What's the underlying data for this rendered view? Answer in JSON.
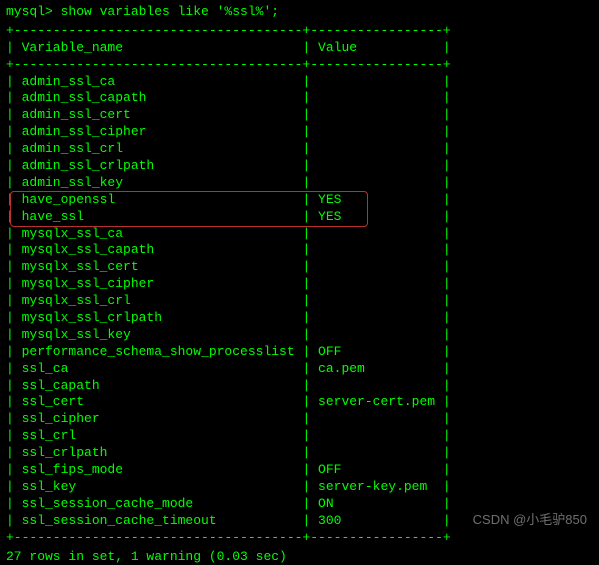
{
  "prompt": "mysql> show variables like '%ssl%';",
  "border_top": "+-------------------------------------+-----------------+",
  "header_line": "| Variable_name                       | Value           |",
  "border_mid": "+-------------------------------------+-----------------+",
  "rows": [
    {
      "name": "admin_ssl_ca",
      "value": ""
    },
    {
      "name": "admin_ssl_capath",
      "value": ""
    },
    {
      "name": "admin_ssl_cert",
      "value": ""
    },
    {
      "name": "admin_ssl_cipher",
      "value": ""
    },
    {
      "name": "admin_ssl_crl",
      "value": ""
    },
    {
      "name": "admin_ssl_crlpath",
      "value": ""
    },
    {
      "name": "admin_ssl_key",
      "value": ""
    },
    {
      "name": "have_openssl",
      "value": "YES",
      "highlight": true
    },
    {
      "name": "have_ssl",
      "value": "YES",
      "highlight": true
    },
    {
      "name": "mysqlx_ssl_ca",
      "value": ""
    },
    {
      "name": "mysqlx_ssl_capath",
      "value": ""
    },
    {
      "name": "mysqlx_ssl_cert",
      "value": ""
    },
    {
      "name": "mysqlx_ssl_cipher",
      "value": ""
    },
    {
      "name": "mysqlx_ssl_crl",
      "value": ""
    },
    {
      "name": "mysqlx_ssl_crlpath",
      "value": ""
    },
    {
      "name": "mysqlx_ssl_key",
      "value": ""
    },
    {
      "name": "performance_schema_show_processlist",
      "value": "OFF"
    },
    {
      "name": "ssl_ca",
      "value": "ca.pem"
    },
    {
      "name": "ssl_capath",
      "value": ""
    },
    {
      "name": "ssl_cert",
      "value": "server-cert.pem"
    },
    {
      "name": "ssl_cipher",
      "value": ""
    },
    {
      "name": "ssl_crl",
      "value": ""
    },
    {
      "name": "ssl_crlpath",
      "value": ""
    },
    {
      "name": "ssl_fips_mode",
      "value": "OFF"
    },
    {
      "name": "ssl_key",
      "value": "server-key.pem"
    },
    {
      "name": "ssl_session_cache_mode",
      "value": "ON"
    },
    {
      "name": "ssl_session_cache_timeout",
      "value": "300"
    }
  ],
  "border_bot": "+-------------------------------------+-----------------+",
  "status": "27 rows in set, 1 warning (0.03 sec)",
  "watermark": "CSDN @小毛驴850",
  "col1_width": 37,
  "col2_width": 17
}
